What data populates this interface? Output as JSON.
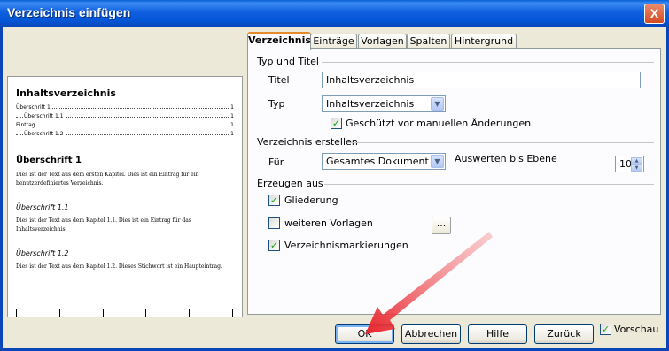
{
  "window": {
    "title": "Verzeichnis einfügen",
    "close_glyph": "X"
  },
  "tabs": [
    {
      "label": "Verzeichnis",
      "active": true
    },
    {
      "label": "Einträge",
      "active": false
    },
    {
      "label": "Vorlagen",
      "active": false
    },
    {
      "label": "Spalten",
      "active": false
    },
    {
      "label": "Hintergrund",
      "active": false
    }
  ],
  "type_section": {
    "heading": "Typ und Titel",
    "title_label": "Titel",
    "title_value": "Inhaltsverzeichnis",
    "type_label": "Typ",
    "type_value": "Inhaltsverzeichnis",
    "protected_label": "Geschützt vor manuellen Änderungen",
    "protected_checked": true
  },
  "create_section": {
    "heading": "Verzeichnis erstellen",
    "for_label": "Für",
    "for_value": "Gesamtes Dokument",
    "evaluate_label": "Auswerten bis Ebene",
    "level_value": "10"
  },
  "generate_section": {
    "heading": "Erzeugen aus",
    "outline_label": "Gliederung",
    "outline_checked": true,
    "more_styles_label": "weiteren Vorlagen",
    "more_styles_checked": false,
    "more_styles_button": "...",
    "index_marks_label": "Verzeichnismarkierungen",
    "index_marks_checked": true
  },
  "buttons": {
    "ok": "OK",
    "cancel": "Abbrechen",
    "help": "Hilfe",
    "back": "Zurück",
    "preview_label": "Vorschau",
    "preview_checked": true
  },
  "preview": {
    "toc_title": "Inhaltsverzeichnis",
    "toc_entries": [
      {
        "label": "Überschrift 1",
        "page": "1"
      },
      {
        "label": "Überschrift 1.1",
        "page": "1"
      },
      {
        "label": "Eintrag",
        "page": "1"
      },
      {
        "label": "Überschrift 1.2",
        "page": "1"
      }
    ],
    "h1": "Überschrift 1",
    "p1": "Dies ist der Text aus dem ersten Kapitel. Dies ist ein Eintrag für ein benutzerdefiniertes Verzeichnis.",
    "h11": "Überschrift 1.1",
    "p11": "Dies ist der Text aus dem Kapitel 1.1. Dies ist ein Eintrag für das Inhaltsverzeichnis.",
    "h12": "Überschrift 1.2",
    "p12": "Dies ist der Text aus dem Kapitel 1.2. Dieses Stichwort ist ein Haupteintrag."
  },
  "colors": {
    "titlebar": "#0a5fd6",
    "annotation_arrow": "#e8232b",
    "check": "#21a121"
  }
}
